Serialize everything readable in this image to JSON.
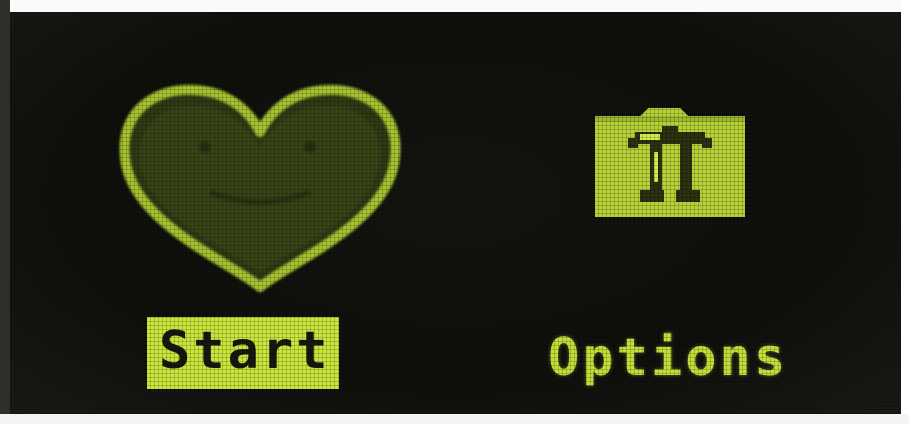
{
  "menu": {
    "items": [
      {
        "label": "Start",
        "icon": "heart-icon",
        "selected": true
      },
      {
        "label": "Options",
        "icon": "robot-folder-icon",
        "selected": false
      }
    ]
  },
  "colors": {
    "screen_background": "#0f0f0c",
    "lcd_green": "#c2e03a",
    "highlight_background": "#c8e63c",
    "highlight_text": "#141810"
  }
}
